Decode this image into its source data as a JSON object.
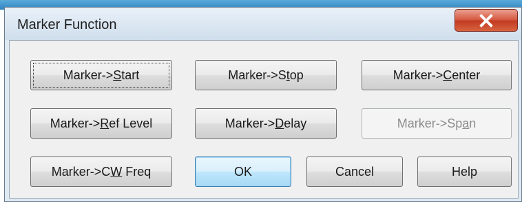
{
  "dialog": {
    "title": "Marker Function",
    "close_label": "X"
  },
  "buttons": [
    {
      "id": "start",
      "pre": "Marker->",
      "ul": "S",
      "post": "tart",
      "state": "focused"
    },
    {
      "id": "stop",
      "pre": "Marker->S",
      "ul": "t",
      "post": "op",
      "state": "normal"
    },
    {
      "id": "center",
      "pre": "Marker->",
      "ul": "C",
      "post": "enter",
      "state": "normal"
    },
    {
      "id": "ref-level",
      "pre": "Marker->",
      "ul": "R",
      "post": "ef Level",
      "state": "normal"
    },
    {
      "id": "delay",
      "pre": "Marker->",
      "ul": "D",
      "post": "elay",
      "state": "normal"
    },
    {
      "id": "span",
      "pre": "Marker->Sp",
      "ul": "a",
      "post": "n",
      "state": "disabled"
    },
    {
      "id": "cw-freq",
      "pre": "Marker->C",
      "ul": "W",
      "post": " Freq",
      "state": "normal"
    },
    {
      "id": "ok",
      "pre": "OK",
      "ul": "",
      "post": "",
      "state": "default"
    },
    {
      "id": "cancel",
      "pre": "Cancel",
      "ul": "",
      "post": "",
      "state": "normal"
    },
    {
      "id": "help",
      "pre": "Help",
      "ul": "",
      "post": "",
      "state": "normal"
    }
  ]
}
